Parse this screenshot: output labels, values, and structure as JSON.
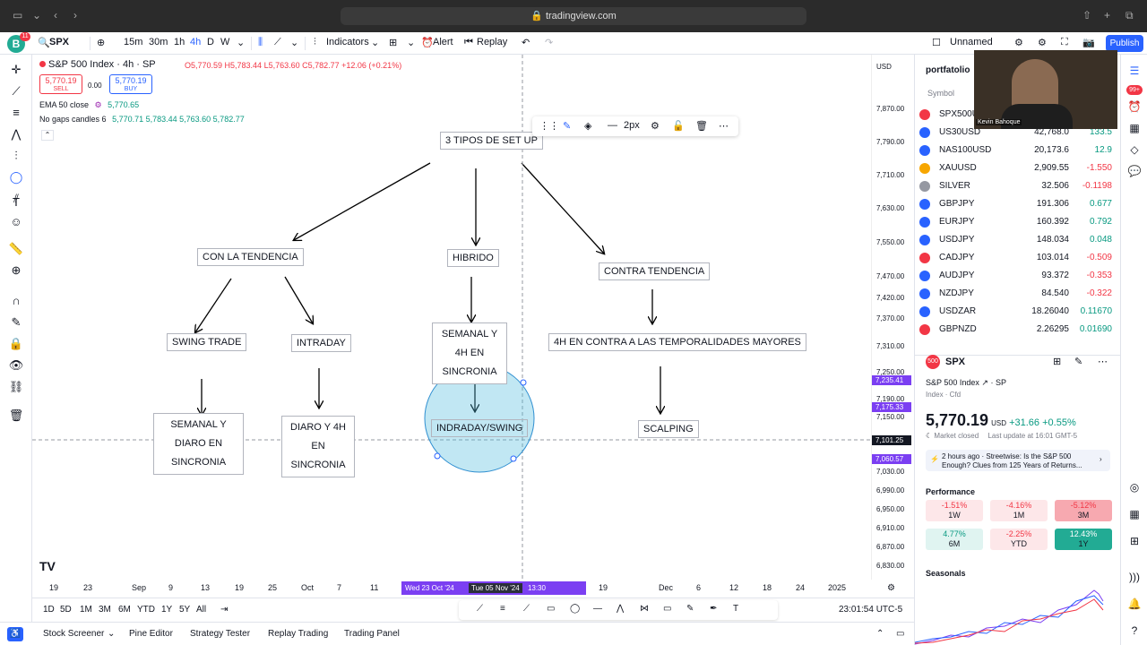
{
  "browser": {
    "url": "tradingview.com"
  },
  "toolbar": {
    "logo_badge": "11",
    "symbol": "SPX",
    "intervals": [
      "15m",
      "30m",
      "1h",
      "4h",
      "D",
      "W"
    ],
    "indicators_label": "Indicators",
    "alert_label": "Alert",
    "replay_label": "Replay",
    "layout_name": "Unnamed",
    "publish_label": "Publish"
  },
  "legend": {
    "title": "S&P 500 Index · 4h · SP",
    "ohlc": "O5,770.59 H5,783.44 L5,763.60 C5,782.77 +12.06 (+0.21%)",
    "sell_price": "5,770.19",
    "sell_label": "SELL",
    "spread": "0.00",
    "buy_price": "5,770.19",
    "buy_label": "BUY",
    "ema_label": "EMA 50 close",
    "ema_value": "5,770.65",
    "nogap_label": "No gaps candles 6",
    "nogap_values": "5,770.71  5,783.44  5,763.60  5,782.77"
  },
  "drawing_toolbar": {
    "width_label": "2px"
  },
  "diagram": {
    "root": "3 TIPOS DE SET UP",
    "con_tendencia": "CON LA TENDENCIA",
    "hibrido": "HIBRIDO",
    "contra_tendencia": "CONTRA TENDENCIA",
    "swing_trade": "SWING TRADE",
    "intraday": "INTRADAY",
    "semanal_4h": "SEMANAL Y 4H EN SINCRONIA",
    "contra_4h": "4H EN CONTRA A LAS TEMPORALIDADES MAYORES",
    "semanal_diario": "SEMANAL Y DIARO EN SINCRONIA",
    "diario_4h": "DIARO Y 4H EN SINCRONIA",
    "intraday_swing": "INDRADAY/SWING",
    "scalping": "SCALPING"
  },
  "price_axis": {
    "currency": "USD",
    "labels": [
      "7,870.00",
      "7,790.00",
      "7,710.00",
      "7,630.00",
      "7,550.00",
      "7,470.00",
      "7,420.00",
      "7,370.00",
      "7,310.00",
      "7,250.00",
      "7,190.00",
      "7,150.00",
      "7,030.00",
      "6,990.00",
      "6,950.00",
      "6,910.00",
      "6,870.00",
      "6,830.00"
    ],
    "tag_top": "7,235.41",
    "tag_mid": "7,175.33",
    "tag_cursor": "7,101.25",
    "tag_bottom": "7,060.57"
  },
  "time_axis": {
    "labels": [
      "19",
      "23",
      "Sep",
      "9",
      "13",
      "19",
      "25",
      "Oct",
      "7",
      "11",
      "19",
      "Dec",
      "6",
      "12",
      "18",
      "24",
      "2025"
    ],
    "range_start": "Wed 23 Oct '24",
    "range_end": "Tue 05 Nov '24",
    "range_time": "13:30"
  },
  "range_bar": {
    "ranges": [
      "1D",
      "5D",
      "1M",
      "3M",
      "6M",
      "YTD",
      "1Y",
      "5Y",
      "All"
    ],
    "clock": "23:01:54 UTC-5"
  },
  "bottom_tabs": [
    "Stock Screener",
    "Pine Editor",
    "Strategy Tester",
    "Replay Trading",
    "Trading Panel"
  ],
  "watchlist": {
    "title": "portfatolio",
    "col_symbol": "Symbol",
    "rows": [
      {
        "sym": "SPX500USD",
        "last": "",
        "chg": "",
        "dir": "pos",
        "color": "#f23645"
      },
      {
        "sym": "US30USD",
        "last": "42,768.0",
        "chg": "133.5",
        "dir": "pos",
        "color": "#2962ff"
      },
      {
        "sym": "NAS100USD",
        "last": "20,173.6",
        "chg": "12.9",
        "dir": "pos",
        "color": "#2962ff"
      },
      {
        "sym": "XAUUSD",
        "last": "2,909.55",
        "chg": "-1.550",
        "dir": "neg",
        "color": "#f7a600"
      },
      {
        "sym": "SILVER",
        "last": "32.506",
        "chg": "-0.1198",
        "dir": "neg",
        "color": "#9598a1"
      },
      {
        "sym": "GBPJPY",
        "last": "191.306",
        "chg": "0.677",
        "dir": "pos",
        "color": "#2962ff"
      },
      {
        "sym": "EURJPY",
        "last": "160.392",
        "chg": "0.792",
        "dir": "pos",
        "color": "#2962ff"
      },
      {
        "sym": "USDJPY",
        "last": "148.034",
        "chg": "0.048",
        "dir": "pos",
        "color": "#2962ff"
      },
      {
        "sym": "CADJPY",
        "last": "103.014",
        "chg": "-0.509",
        "dir": "neg",
        "color": "#f23645"
      },
      {
        "sym": "AUDJPY",
        "last": "93.372",
        "chg": "-0.353",
        "dir": "neg",
        "color": "#2962ff"
      },
      {
        "sym": "NZDJPY",
        "last": "84.540",
        "chg": "-0.322",
        "dir": "neg",
        "color": "#2962ff"
      },
      {
        "sym": "USDZAR",
        "last": "18.26040",
        "chg": "0.11670",
        "dir": "pos",
        "color": "#2962ff"
      },
      {
        "sym": "GBPNZD",
        "last": "2.26295",
        "chg": "0.01690",
        "dir": "pos",
        "color": "#f23645"
      }
    ]
  },
  "details": {
    "symbol": "SPX",
    "name": "S&P 500 Index",
    "exchange": "SP",
    "type": "Index · Cfd",
    "price": "5,770.19",
    "currency": "USD",
    "change": "+31.66",
    "change_pct": "+0.55%",
    "market_status": "Market closed",
    "last_update": "Last update at 16:01 GMT-5",
    "news": "2 hours ago · Streetwise: Is the S&P 500 Enough? Clues from 125 Years of Returns...",
    "performance_title": "Performance",
    "performance": [
      {
        "value": "-1.51%",
        "label": "1W",
        "dir": "neg"
      },
      {
        "value": "-4.16%",
        "label": "1M",
        "dir": "neg"
      },
      {
        "value": "-5.12%",
        "label": "3M",
        "dir": "neg"
      },
      {
        "value": "4.77%",
        "label": "6M",
        "dir": "pos"
      },
      {
        "value": "-2.25%",
        "label": "YTD",
        "dir": "neg"
      },
      {
        "value": "12.43%",
        "label": "1Y",
        "dir": "pos"
      }
    ],
    "seasonals_title": "Seasonals"
  },
  "webcam": {
    "caption": "Kevin Bahoque"
  }
}
